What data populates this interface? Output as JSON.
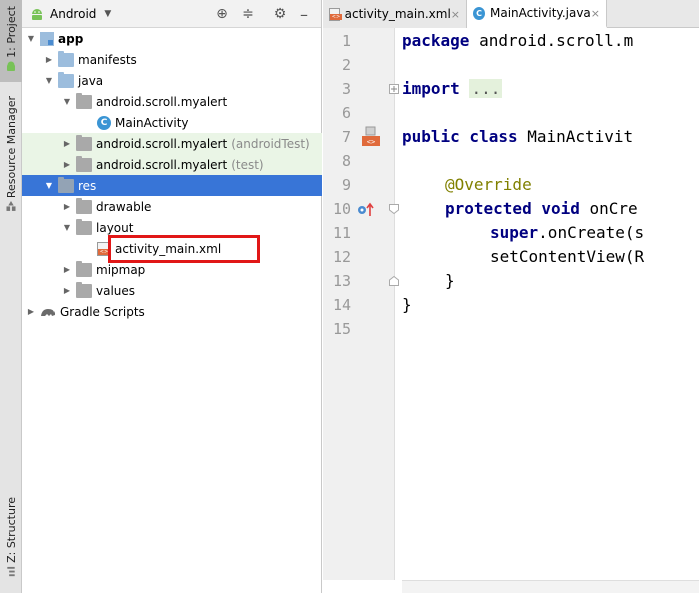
{
  "sidebar": {
    "project_tab": "1: Project",
    "resource_tab": "Resource Manager",
    "structure_tab": "Z: Structure"
  },
  "project_panel": {
    "view": "Android",
    "tree": [
      {
        "label": "app",
        "sub": ""
      },
      {
        "label": "manifests",
        "sub": ""
      },
      {
        "label": "java",
        "sub": ""
      },
      {
        "label": "android.scroll.myalert",
        "sub": ""
      },
      {
        "label": "MainActivity",
        "sub": ""
      },
      {
        "label": "android.scroll.myalert",
        "sub": "(androidTest)"
      },
      {
        "label": "android.scroll.myalert",
        "sub": "(test)"
      },
      {
        "label": "res",
        "sub": ""
      },
      {
        "label": "drawable",
        "sub": ""
      },
      {
        "label": "layout",
        "sub": ""
      },
      {
        "label": "activity_main.xml",
        "sub": ""
      },
      {
        "label": "mipmap",
        "sub": ""
      },
      {
        "label": "values",
        "sub": ""
      },
      {
        "label": "Gradle Scripts",
        "sub": ""
      }
    ]
  },
  "editor": {
    "tabs": [
      {
        "label": "activity_main.xml",
        "close": "×"
      },
      {
        "label": "MainActivity.java",
        "close": "×"
      }
    ],
    "line_numbers": [
      "1",
      "2",
      "3",
      "6",
      "7",
      "8",
      "9",
      "10",
      "11",
      "12",
      "13",
      "14",
      "15"
    ],
    "code": {
      "l1_kw": "package",
      "l1_rest": " android.scroll.m",
      "l3_kw": "import",
      "l3_fold": "...",
      "l7_kw": "public class",
      "l7_rest": " MainActivit",
      "l10_ann": "@Override",
      "l10b_kw": "protected void",
      "l10b_rest": " onCre",
      "l11_kw": "super",
      "l11_rest": ".onCreate(s",
      "l12": "setContentView(R",
      "l13": "}",
      "l14": "}"
    }
  },
  "colors": {
    "selection": "#3875d7",
    "highlight_box": "#e11717",
    "keyword": "#000080",
    "annotation": "#808000"
  }
}
